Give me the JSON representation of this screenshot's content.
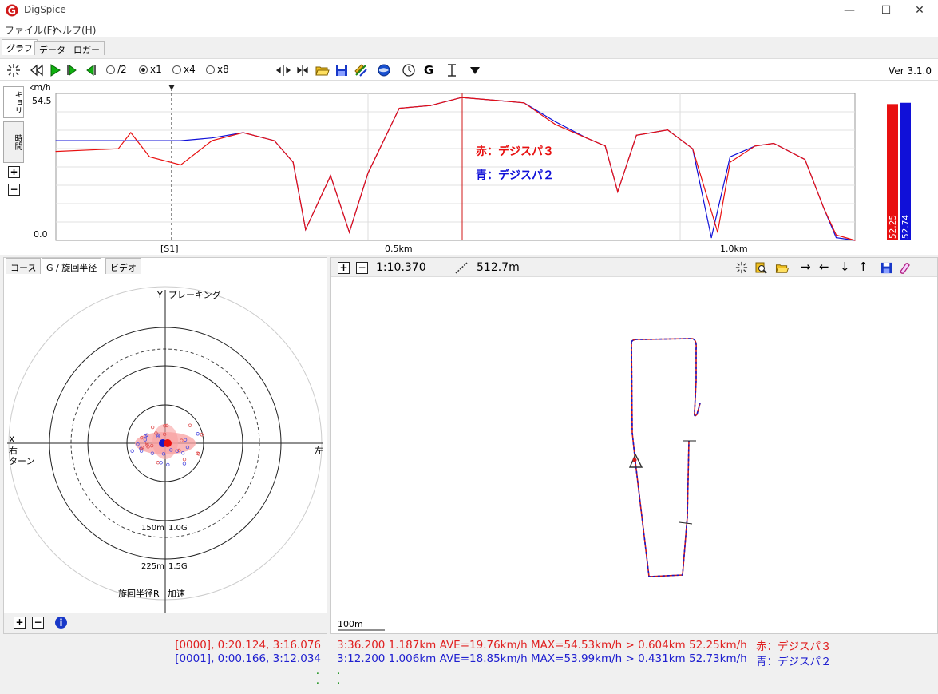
{
  "window": {
    "title": "DigSpice",
    "minimize": "—",
    "maximize": "☐",
    "close": "✕"
  },
  "menu": {
    "file": "ファイル(F)",
    "help": "ヘルプ(H)"
  },
  "main_tabs": [
    "グラフ",
    "データ",
    "ロガー"
  ],
  "toolbar": {
    "speed_half": "/2",
    "speed_x1": "x1",
    "speed_x4": "x4",
    "speed_x8": "x8",
    "selected": "x1",
    "g_label": "G",
    "version": "Ver 3.1.0"
  },
  "graph": {
    "side_tabs": [
      "キョリ",
      "時間"
    ],
    "unit": "km/h",
    "ymax_label": "54.5",
    "ymin_label": "0.0",
    "x_ticks": [
      "[S1]",
      "0.5km",
      "1.0km"
    ],
    "legend_red": "赤：デジスパ３",
    "legend_blue": "青：デジスパ２",
    "bar_red_value": 52.25,
    "bar_blue_value": 52.74,
    "bar_red_label": "52.25",
    "bar_blue_label": "52.74",
    "colors": {
      "red": "#e81010",
      "blue": "#1010d8"
    }
  },
  "chart_data": {
    "type": "line",
    "xlabel": "",
    "ylabel": "km/h",
    "ylim": [
      0,
      54.5
    ],
    "x_unit": "km",
    "series": [
      {
        "color": "#e81010",
        "x": [
          0,
          0.1,
          0.12,
          0.15,
          0.2,
          0.25,
          0.3,
          0.35,
          0.38,
          0.4,
          0.44,
          0.47,
          0.5,
          0.55,
          0.6,
          0.65,
          0.7,
          0.75,
          0.8,
          0.85,
          0.88,
          0.9,
          0.93,
          0.98,
          1.02,
          1.06,
          1.08,
          1.12,
          1.15,
          1.2,
          1.23,
          1.25,
          1.28
        ],
        "y": [
          33,
          34,
          40,
          31,
          28,
          37,
          40,
          37,
          29,
          4,
          24,
          3,
          25,
          49,
          50,
          53,
          52,
          51,
          43,
          38,
          35,
          18,
          39,
          41,
          34,
          3,
          29,
          35,
          36,
          30,
          12,
          2,
          0
        ]
      },
      {
        "color": "#1010d8",
        "x": [
          0,
          0.1,
          0.15,
          0.2,
          0.25,
          0.3,
          0.35,
          0.38,
          0.4,
          0.44,
          0.47,
          0.5,
          0.55,
          0.6,
          0.65,
          0.7,
          0.75,
          0.8,
          0.85,
          0.88,
          0.9,
          0.93,
          0.98,
          1.02,
          1.05,
          1.08,
          1.12,
          1.15,
          1.2,
          1.23,
          1.25,
          1.28
        ],
        "y": [
          37,
          37,
          37,
          37,
          38,
          40,
          37,
          29,
          4,
          24,
          3,
          25,
          49,
          50,
          53,
          52,
          51,
          44,
          38,
          35,
          18,
          39,
          41,
          34,
          1,
          31,
          35,
          36,
          30,
          12,
          1,
          0
        ]
      }
    ]
  },
  "lower_left": {
    "tabs": [
      "コース",
      "G / 旋回半径",
      "ビデオ"
    ],
    "label_y": "Y",
    "label_braking": "ブレーキング",
    "label_x": "X",
    "label_right": "右",
    "label_turn": "ターン",
    "label_left": "左",
    "ring1_r": "150m",
    "ring1_g": "1.0G",
    "ring2_r": "225m",
    "ring2_g": "1.5G",
    "label_radius": "旋回半径R",
    "label_accel": "加速"
  },
  "lower_right": {
    "lap_time": "1:10.370",
    "distance": "512.7m",
    "scale": "100m"
  },
  "status": {
    "left_red": "[0000], 0:20.124, 3:16.076",
    "left_blue": "[0001], 0:00.166, 3:12.034",
    "dot1": ".",
    "dot2": ".",
    "right_red": "3:36.200 1.187km AVE=19.76km/h MAX=54.53km/h > 0.604km 52.25km/h",
    "right_blue": "3:12.200 1.006km AVE=18.85km/h MAX=53.99km/h > 0.431km 52.73km/h",
    "right_red_name": "赤：デジスパ３",
    "right_blue_name": "青：デジスパ２"
  }
}
